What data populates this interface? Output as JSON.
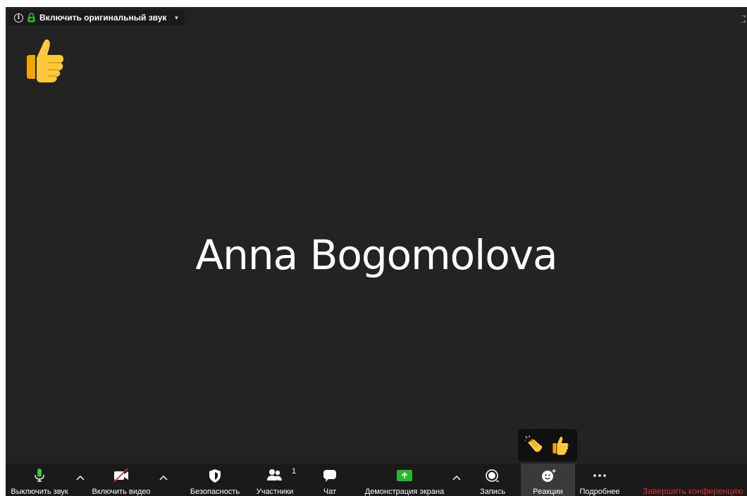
{
  "top_bar": {
    "original_sound_label": "Включить оригинальный звук"
  },
  "main": {
    "participant_name": "Anna Bogomolova"
  },
  "toolbar": {
    "mute_label": "Выключить звук",
    "video_label": "Включить видео",
    "security_label": "Безопасность",
    "participants_label": "Участники",
    "participants_count": "1",
    "chat_label": "Чат",
    "share_label": "Демонстрация экрана",
    "record_label": "Запись",
    "reactions_label": "Реакции",
    "more_label": "Подробнее",
    "end_label": "Завершить конференцию"
  },
  "colors": {
    "background": "#232323",
    "toolbar": "#1a1a1a",
    "mic_green": "#3ec53e",
    "share_green": "#28b928",
    "end_red": "#e02f2f"
  },
  "icons": [
    "info-icon",
    "lock-icon",
    "thumbs-up-icon",
    "clapping-hands-icon",
    "microphone-icon",
    "video-off-icon",
    "shield-icon",
    "participants-icon",
    "chat-icon",
    "share-screen-icon",
    "record-icon",
    "reactions-icon",
    "more-icon",
    "fullscreen-icon"
  ]
}
